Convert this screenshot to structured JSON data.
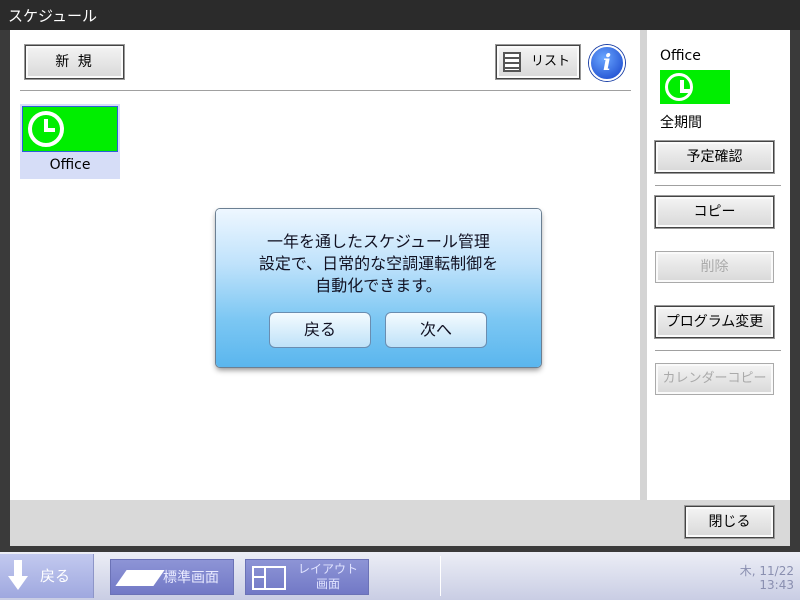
{
  "window": {
    "title": "スケジュール"
  },
  "toolbar": {
    "new_label": "新 規",
    "list_label": "リスト",
    "info_icon": "info-icon"
  },
  "tiles": [
    {
      "label": "Office",
      "icon": "clock-icon",
      "color": "#00ee00"
    }
  ],
  "side": {
    "name": "Office",
    "period": "全期間",
    "confirm_label": "予定確認",
    "copy_label": "コピー",
    "delete_label": "削除",
    "program_change_label": "プログラム変更",
    "calendar_copy_label": "カレンダーコピー"
  },
  "footer": {
    "close_label": "閉じる"
  },
  "dialog": {
    "message": "一年を通したスケジュール管理\n設定で、日常的な空調運転制御を\n自動化できます。",
    "back_label": "戻る",
    "next_label": "次へ"
  },
  "taskbar": {
    "back_label": "戻る",
    "standard_label": "標準画面",
    "layout_label_1": "レイアウト",
    "layout_label_2": "画面",
    "date": "木, 11/22",
    "time": "13:43"
  },
  "colors": {
    "accent_green": "#00ee00",
    "dialog_blue": "#7cc7f3",
    "taskbar_purple": "#7279c6"
  }
}
